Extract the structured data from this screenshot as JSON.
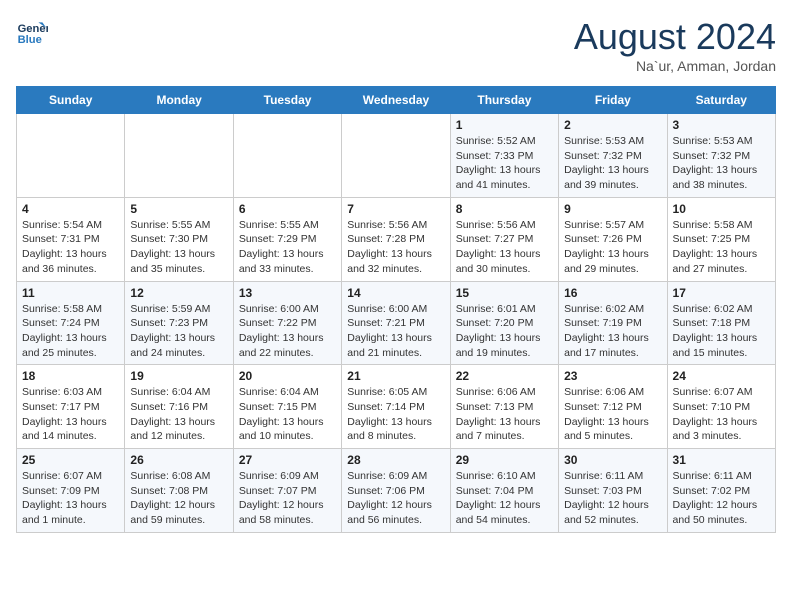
{
  "header": {
    "logo_line1": "General",
    "logo_line2": "Blue",
    "month": "August 2024",
    "location": "Na`ur, Amman, Jordan"
  },
  "days_of_week": [
    "Sunday",
    "Monday",
    "Tuesday",
    "Wednesday",
    "Thursday",
    "Friday",
    "Saturday"
  ],
  "weeks": [
    [
      {
        "num": "",
        "info": ""
      },
      {
        "num": "",
        "info": ""
      },
      {
        "num": "",
        "info": ""
      },
      {
        "num": "",
        "info": ""
      },
      {
        "num": "1",
        "info": "Sunrise: 5:52 AM\nSunset: 7:33 PM\nDaylight: 13 hours\nand 41 minutes."
      },
      {
        "num": "2",
        "info": "Sunrise: 5:53 AM\nSunset: 7:32 PM\nDaylight: 13 hours\nand 39 minutes."
      },
      {
        "num": "3",
        "info": "Sunrise: 5:53 AM\nSunset: 7:32 PM\nDaylight: 13 hours\nand 38 minutes."
      }
    ],
    [
      {
        "num": "4",
        "info": "Sunrise: 5:54 AM\nSunset: 7:31 PM\nDaylight: 13 hours\nand 36 minutes."
      },
      {
        "num": "5",
        "info": "Sunrise: 5:55 AM\nSunset: 7:30 PM\nDaylight: 13 hours\nand 35 minutes."
      },
      {
        "num": "6",
        "info": "Sunrise: 5:55 AM\nSunset: 7:29 PM\nDaylight: 13 hours\nand 33 minutes."
      },
      {
        "num": "7",
        "info": "Sunrise: 5:56 AM\nSunset: 7:28 PM\nDaylight: 13 hours\nand 32 minutes."
      },
      {
        "num": "8",
        "info": "Sunrise: 5:56 AM\nSunset: 7:27 PM\nDaylight: 13 hours\nand 30 minutes."
      },
      {
        "num": "9",
        "info": "Sunrise: 5:57 AM\nSunset: 7:26 PM\nDaylight: 13 hours\nand 29 minutes."
      },
      {
        "num": "10",
        "info": "Sunrise: 5:58 AM\nSunset: 7:25 PM\nDaylight: 13 hours\nand 27 minutes."
      }
    ],
    [
      {
        "num": "11",
        "info": "Sunrise: 5:58 AM\nSunset: 7:24 PM\nDaylight: 13 hours\nand 25 minutes."
      },
      {
        "num": "12",
        "info": "Sunrise: 5:59 AM\nSunset: 7:23 PM\nDaylight: 13 hours\nand 24 minutes."
      },
      {
        "num": "13",
        "info": "Sunrise: 6:00 AM\nSunset: 7:22 PM\nDaylight: 13 hours\nand 22 minutes."
      },
      {
        "num": "14",
        "info": "Sunrise: 6:00 AM\nSunset: 7:21 PM\nDaylight: 13 hours\nand 21 minutes."
      },
      {
        "num": "15",
        "info": "Sunrise: 6:01 AM\nSunset: 7:20 PM\nDaylight: 13 hours\nand 19 minutes."
      },
      {
        "num": "16",
        "info": "Sunrise: 6:02 AM\nSunset: 7:19 PM\nDaylight: 13 hours\nand 17 minutes."
      },
      {
        "num": "17",
        "info": "Sunrise: 6:02 AM\nSunset: 7:18 PM\nDaylight: 13 hours\nand 15 minutes."
      }
    ],
    [
      {
        "num": "18",
        "info": "Sunrise: 6:03 AM\nSunset: 7:17 PM\nDaylight: 13 hours\nand 14 minutes."
      },
      {
        "num": "19",
        "info": "Sunrise: 6:04 AM\nSunset: 7:16 PM\nDaylight: 13 hours\nand 12 minutes."
      },
      {
        "num": "20",
        "info": "Sunrise: 6:04 AM\nSunset: 7:15 PM\nDaylight: 13 hours\nand 10 minutes."
      },
      {
        "num": "21",
        "info": "Sunrise: 6:05 AM\nSunset: 7:14 PM\nDaylight: 13 hours\nand 8 minutes."
      },
      {
        "num": "22",
        "info": "Sunrise: 6:06 AM\nSunset: 7:13 PM\nDaylight: 13 hours\nand 7 minutes."
      },
      {
        "num": "23",
        "info": "Sunrise: 6:06 AM\nSunset: 7:12 PM\nDaylight: 13 hours\nand 5 minutes."
      },
      {
        "num": "24",
        "info": "Sunrise: 6:07 AM\nSunset: 7:10 PM\nDaylight: 13 hours\nand 3 minutes."
      }
    ],
    [
      {
        "num": "25",
        "info": "Sunrise: 6:07 AM\nSunset: 7:09 PM\nDaylight: 13 hours\nand 1 minute."
      },
      {
        "num": "26",
        "info": "Sunrise: 6:08 AM\nSunset: 7:08 PM\nDaylight: 12 hours\nand 59 minutes."
      },
      {
        "num": "27",
        "info": "Sunrise: 6:09 AM\nSunset: 7:07 PM\nDaylight: 12 hours\nand 58 minutes."
      },
      {
        "num": "28",
        "info": "Sunrise: 6:09 AM\nSunset: 7:06 PM\nDaylight: 12 hours\nand 56 minutes."
      },
      {
        "num": "29",
        "info": "Sunrise: 6:10 AM\nSunset: 7:04 PM\nDaylight: 12 hours\nand 54 minutes."
      },
      {
        "num": "30",
        "info": "Sunrise: 6:11 AM\nSunset: 7:03 PM\nDaylight: 12 hours\nand 52 minutes."
      },
      {
        "num": "31",
        "info": "Sunrise: 6:11 AM\nSunset: 7:02 PM\nDaylight: 12 hours\nand 50 minutes."
      }
    ]
  ]
}
